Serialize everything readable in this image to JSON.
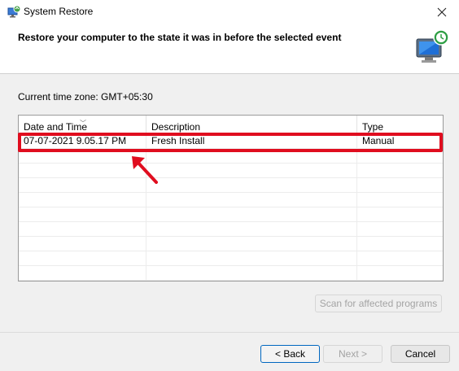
{
  "window": {
    "title": "System Restore",
    "close_icon": "close-icon",
    "app_icon": "system-restore-icon"
  },
  "header": {
    "text": "Restore your computer to the state it was in before the selected event",
    "icon": "computer-restore-icon"
  },
  "timezone": "Current time zone: GMT+05:30",
  "table": {
    "columns": [
      "Date and Time",
      "Description",
      "Type"
    ],
    "rows": [
      {
        "date": "07-07-2021 9.05.17 PM",
        "description": "Fresh Install",
        "type": "Manual"
      }
    ]
  },
  "buttons": {
    "scan": "Scan for affected programs",
    "back": "< Back",
    "next": "Next >",
    "cancel": "Cancel"
  },
  "colors": {
    "highlight": "#e00d1f",
    "focus_border": "#0067c0"
  }
}
